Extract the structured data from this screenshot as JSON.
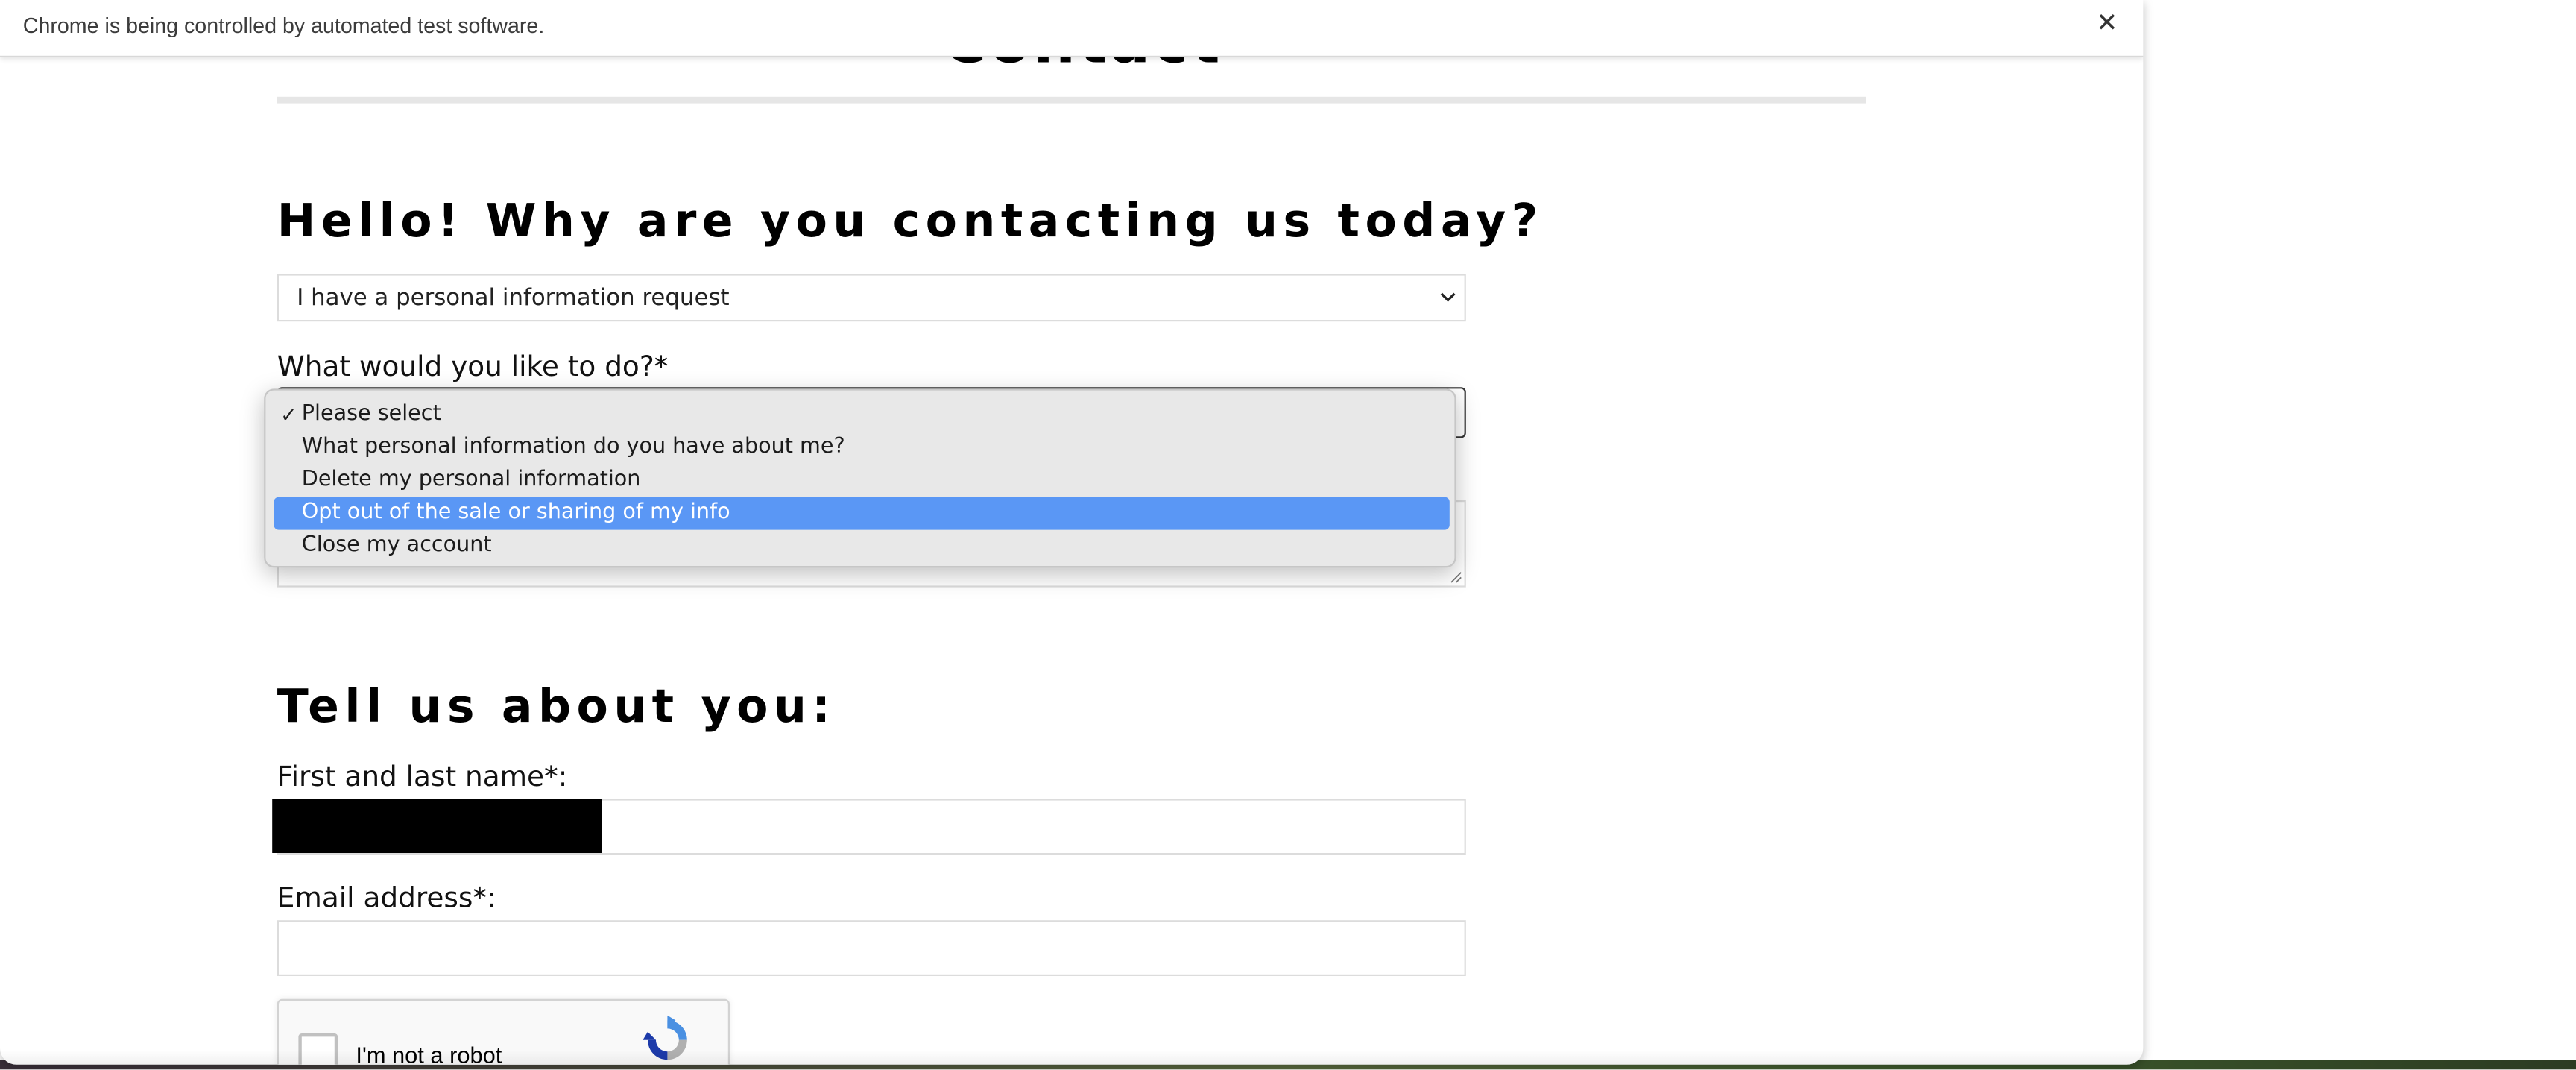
{
  "infobar": {
    "message": "Chrome is being controlled by automated test software.",
    "close_icon": "close-icon"
  },
  "page": {
    "heading": "Contact",
    "why_heading": "Hello! Why are you contacting us today?",
    "reason_select": {
      "value": "I have a personal information request"
    },
    "action_label": "What would you like to do?*",
    "action_select": {
      "options": [
        {
          "label": "Please select",
          "checked": true,
          "highlighted": false
        },
        {
          "label": "What personal information do you have about me?",
          "checked": false,
          "highlighted": false
        },
        {
          "label": "Delete my personal information",
          "checked": false,
          "highlighted": false
        },
        {
          "label": "Opt out of the sale or sharing of my info",
          "checked": false,
          "highlighted": true
        },
        {
          "label": "Close my account",
          "checked": false,
          "highlighted": false
        }
      ],
      "check_glyph": "✓"
    },
    "about_heading": "Tell us about you:",
    "name_label": "First and last name*:",
    "email_label": "Email address*:",
    "recaptcha": {
      "label": "I'm not a robot"
    }
  },
  "colors": {
    "highlight": "#5a97f5",
    "dropdown_bg": "#e8e8e8",
    "rule": "#e6e6e6"
  }
}
